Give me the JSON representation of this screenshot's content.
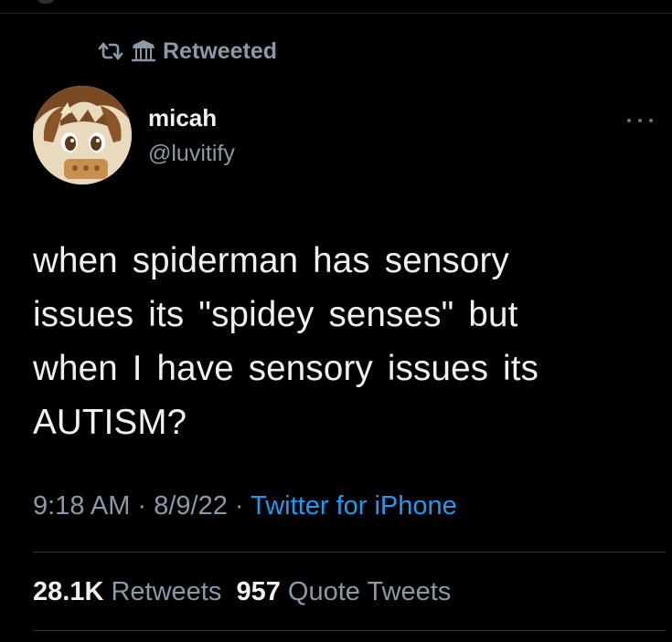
{
  "retweet_context": {
    "label": "Retweeted"
  },
  "author": {
    "display_name": "micah",
    "handle": "@luvitify"
  },
  "tweet": {
    "text_lines": [
      "when spiderman has sensory",
      "issues its \"spidey senses\" but",
      "when I have sensory issues its",
      "AUTISM?"
    ],
    "time": "9:18 AM",
    "date": "8/9/22",
    "source": "Twitter for iPhone",
    "separator": "·"
  },
  "stats": {
    "retweets_count": "28.1K",
    "retweets_label": "Retweets",
    "quote_count": "957",
    "quote_label": "Quote Tweets"
  },
  "colors": {
    "background": "#000000",
    "text_primary": "#eef0f1",
    "text_secondary": "#8b98a5",
    "accent": "#1d9bf0",
    "divider": "#2f3336"
  },
  "icons": [
    "retweet-icon",
    "building-icon",
    "more-options-icon",
    "avatar"
  ]
}
